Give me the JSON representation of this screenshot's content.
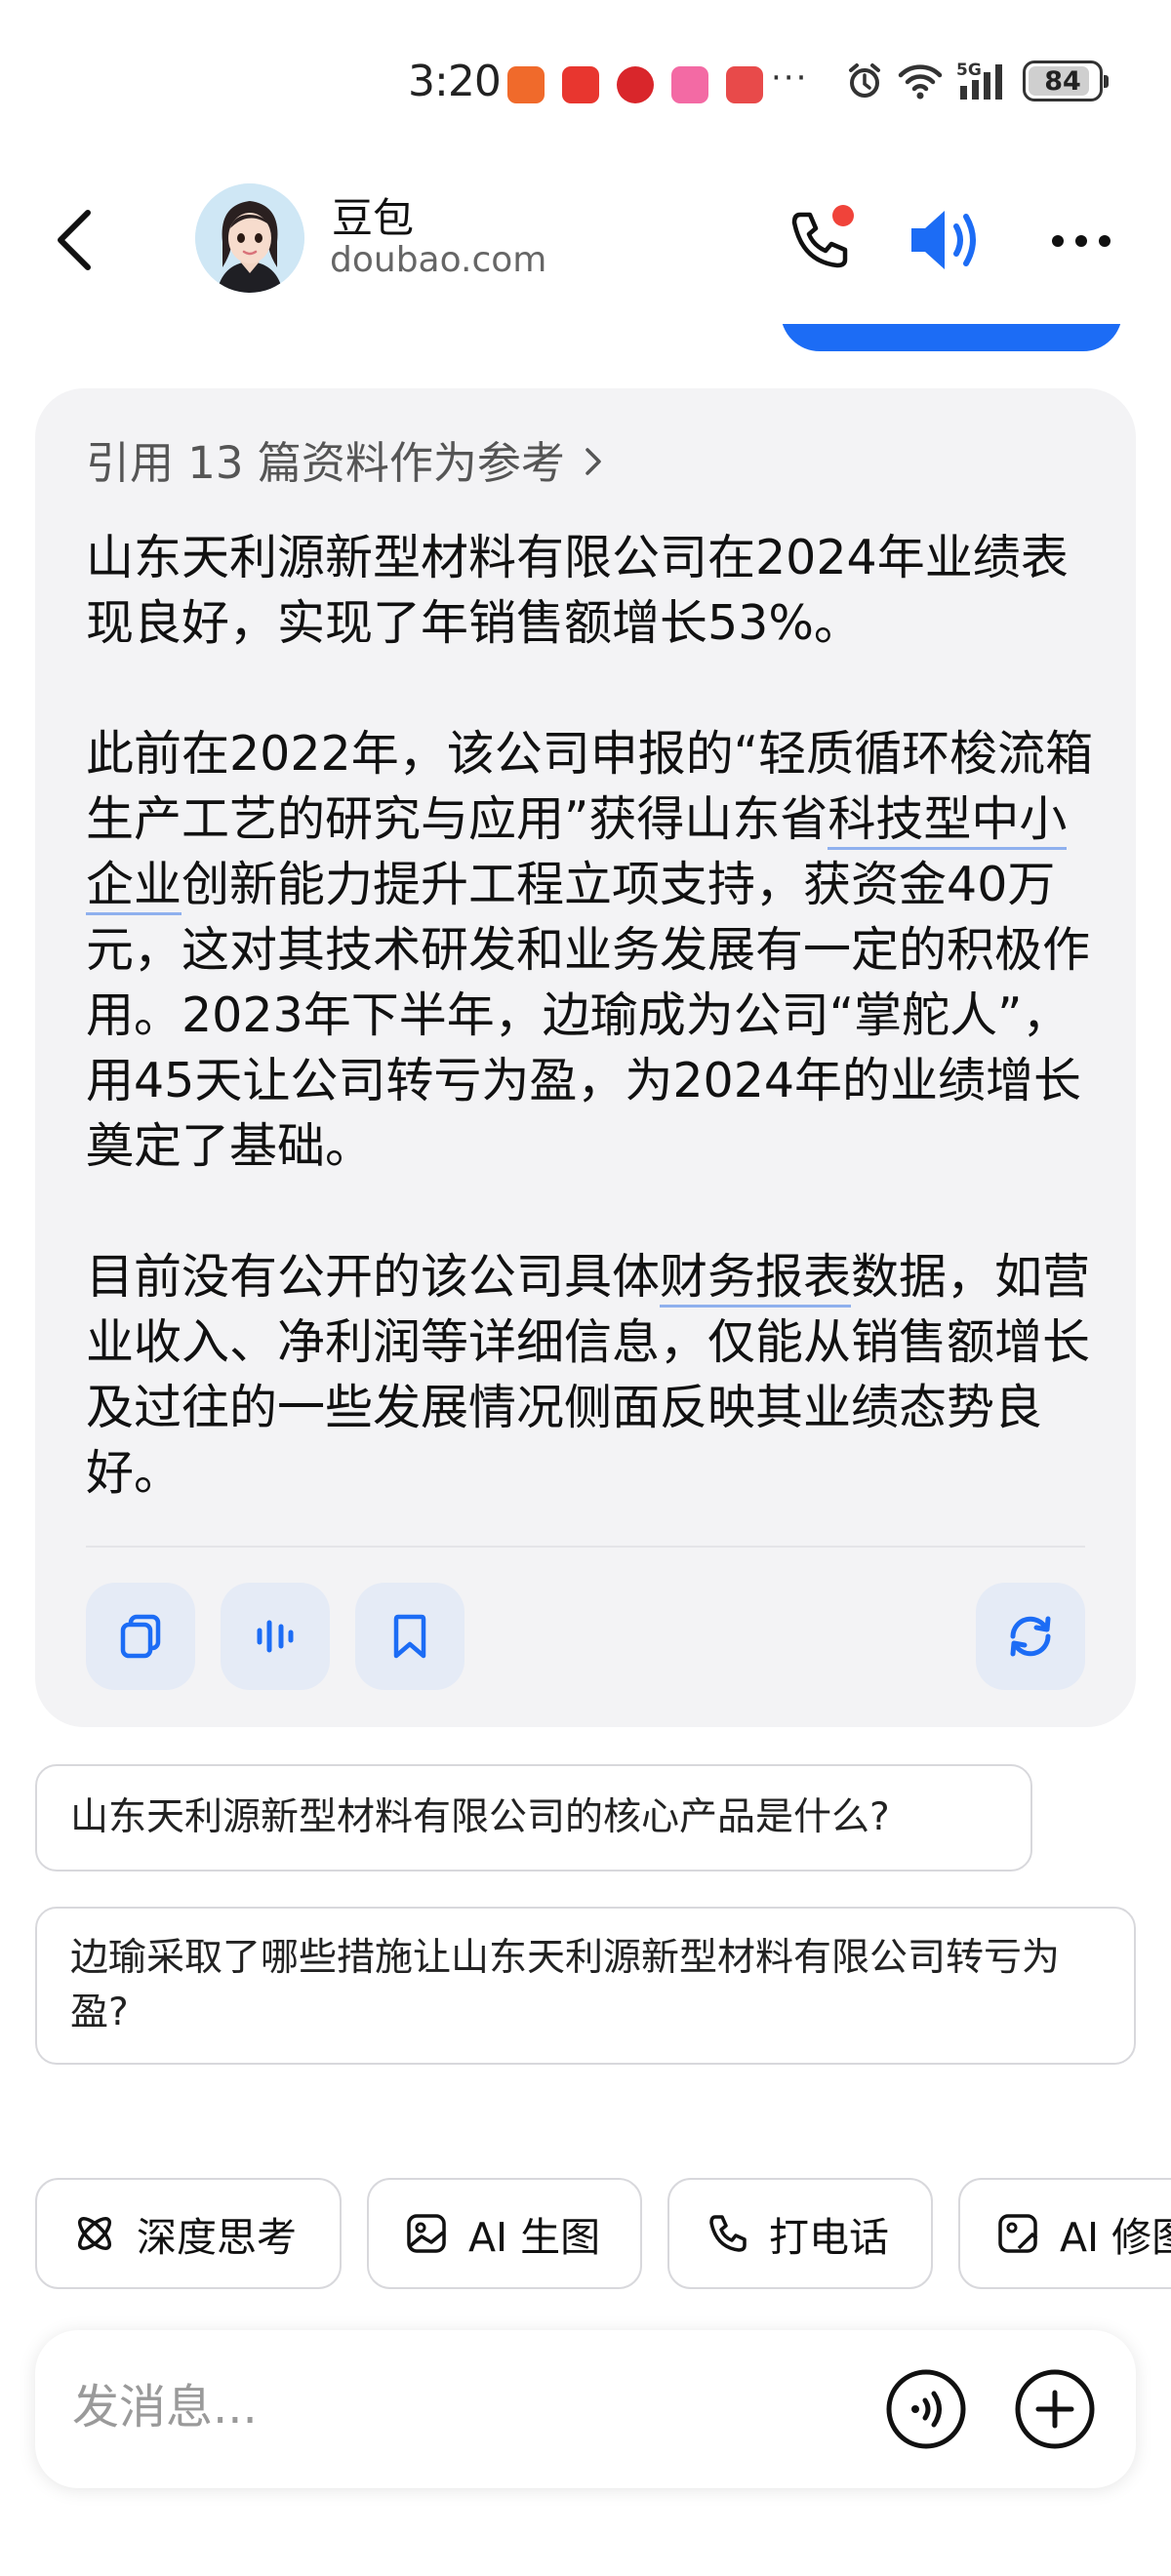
{
  "status_bar": {
    "time": "3:20",
    "more": "···",
    "battery": "84",
    "network": "5G"
  },
  "header": {
    "name": "豆包",
    "domain": "doubao.com"
  },
  "answer": {
    "references": "引用 13 篇资料作为参考",
    "p1": "山东天利源新型材料有限公司在2024年业绩表现良好，实现了年销售额增长53%。",
    "p2_a": "此前在2022年，该公司申报的“轻质循环梭流箱生产工艺的研究与应用”获得山东省",
    "p2_link": "科技型中小企业",
    "p2_b": "创新能力提升工程立项支持，获资金40万元，这对其技术研发和业务发展有一定的积极作用。2023年下半年，边瑜成为公司“掌舵人”，用45天让公司转亏为盈，为2024年的业绩增长奠定了基础。",
    "p3_a": "目前没有公开的该公司具体",
    "p3_link": "财务报表",
    "p3_b": "数据，如营业收入、净利润等详细信息，仅能从销售额增长及过往的一些发展情况侧面反映其业绩态势良好。"
  },
  "suggestions": [
    "山东天利源新型材料有限公司的核心产品是什么?",
    "边瑜采取了哪些措施让山东天利源新型材料有限公司转亏为盈?"
  ],
  "toolbar": {
    "deep_think": "深度思考",
    "ai_image": "AI 生图",
    "phone_call": "打电话",
    "ai_edit": "AI 修图"
  },
  "input": {
    "placeholder": "发消息..."
  },
  "colors": {
    "accent": "#1c6cf5",
    "card_bg": "#f3f3f5",
    "action_bg": "#e5ebf6",
    "notification_dot": "#f0433a"
  }
}
